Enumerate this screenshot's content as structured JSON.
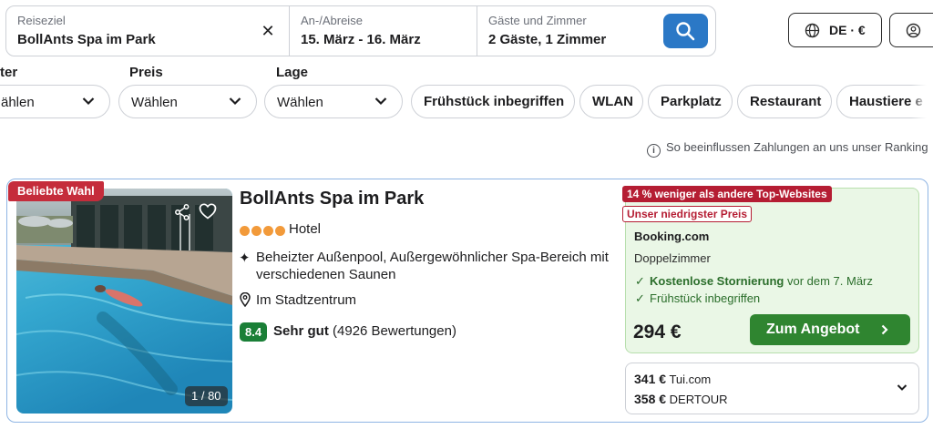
{
  "search": {
    "destination_label": "Reiseziel",
    "destination_value": "BollAnts Spa im Park",
    "clear_symbol": "✕",
    "dates_label": "An-/Abreise",
    "dates_value": "15. März - 16. März",
    "guests_label": "Gäste und Zimmer",
    "guests_value": "2 Gäste, 1 Zimmer",
    "search_icon": "search-icon"
  },
  "header": {
    "locale_label": "DE · €",
    "account_icon": "user-icon"
  },
  "filters": {
    "first_label": "ter",
    "first_value": "ählen",
    "price_label": "Preis",
    "price_value": "Wählen",
    "location_label": "Lage",
    "location_value": "Wählen",
    "chips": [
      "Frühstück inbegriffen",
      "WLAN",
      "Parkplatz",
      "Restaurant",
      "Haustiere e"
    ]
  },
  "ranking_note": "So beeinflussen Zahlungen an uns unser Ranking",
  "hotel": {
    "badge": "Beliebte Wahl",
    "photo_counter": "1 / 80",
    "name": "BollAnts Spa im Park",
    "star_count": 4,
    "type": "Hotel",
    "amenities": "Beheizter Außenpool, Außergewöhnlicher Spa-Bereich mit verschiedenen Saunen",
    "location": "Im Stadtzentrum",
    "rating_score": "8.4",
    "rating_word": "Sehr gut",
    "rating_count": "(4926 Bewertungen)"
  },
  "offer": {
    "savings_tag": "14 % weniger als andere Top-Websites",
    "lowest_price_tag": "Unser niedrigster Preis",
    "provider": "Booking.com",
    "room_type": "Doppelzimmer",
    "perk1_bold": "Kostenlose Stornierung",
    "perk1_rest": " vor dem 7. März",
    "perk2": "Frühstück inbegriffen",
    "price": "294 €",
    "cta": "Zum Angebot"
  },
  "alternatives": [
    {
      "price": "341 €",
      "provider": "Tui.com"
    },
    {
      "price": "358 €",
      "provider": "DERTOUR"
    }
  ],
  "colors": {
    "accent_blue": "#2b78c6",
    "deal_green": "#2f8530",
    "badge_red": "#c52c3b",
    "rating_green": "#1a7f37",
    "star_orange": "#f29a3a"
  }
}
